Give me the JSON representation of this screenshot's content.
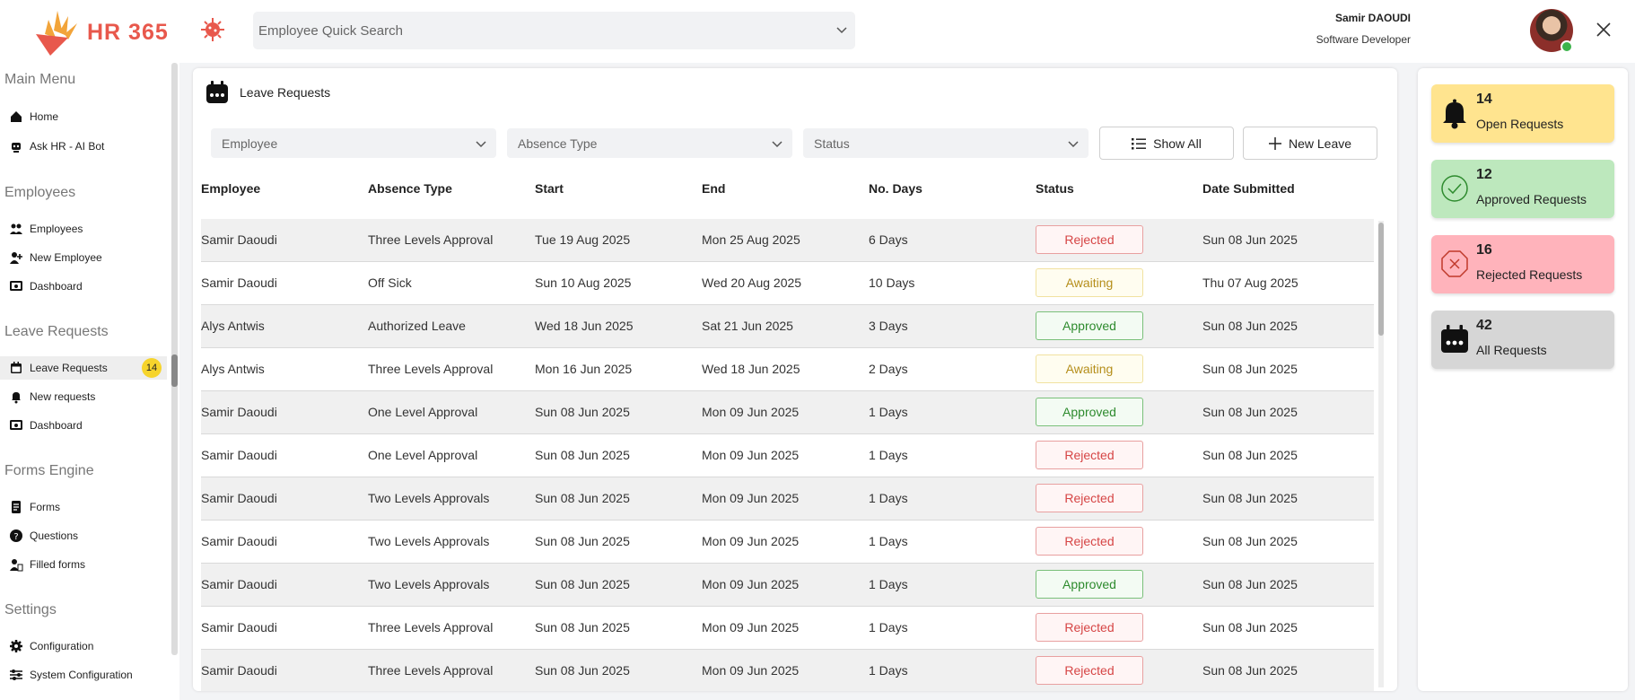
{
  "header": {
    "logo_text": "HR 365",
    "search_placeholder": "Employee Quick Search",
    "user_name": "Samir DAOUDI",
    "user_role": "Software Developer"
  },
  "sidebar": {
    "sections": [
      {
        "title": "Main Menu",
        "items": [
          {
            "label": "Home",
            "icon": "home-icon"
          },
          {
            "label": "Ask HR - AI Bot",
            "icon": "bot-icon"
          }
        ]
      },
      {
        "title": "Employees",
        "items": [
          {
            "label": "Employees",
            "icon": "people-icon"
          },
          {
            "label": "New Employee",
            "icon": "add-person-icon"
          },
          {
            "label": "Dashboard",
            "icon": "dashboard-icon"
          }
        ]
      },
      {
        "title": "Leave Requests",
        "items": [
          {
            "label": "Leave Requests",
            "icon": "calendar-icon",
            "badge": "14",
            "active": true
          },
          {
            "label": "New requests",
            "icon": "bell-icon"
          },
          {
            "label": "Dashboard",
            "icon": "dashboard-icon"
          }
        ]
      },
      {
        "title": "Forms Engine",
        "items": [
          {
            "label": "Forms",
            "icon": "form-icon"
          },
          {
            "label": "Questions",
            "icon": "question-icon"
          },
          {
            "label": "Filled forms",
            "icon": "filled-form-icon"
          }
        ]
      },
      {
        "title": "Settings",
        "items": [
          {
            "label": "Configuration",
            "icon": "gear-icon"
          },
          {
            "label": "System Configuration",
            "icon": "sliders-icon"
          }
        ]
      }
    ]
  },
  "main": {
    "title": "Leave Requests",
    "filters": {
      "employee": "Employee",
      "absence_type": "Absence Type",
      "status": "Status"
    },
    "buttons": {
      "show_all": "Show All",
      "new_leave": "New Leave"
    },
    "columns": [
      "Employee",
      "Absence Type",
      "Start",
      "End",
      "No. Days",
      "Status",
      "Date Submitted"
    ],
    "rows": [
      [
        "Samir Daoudi",
        "Three Levels Approval",
        "Tue 19 Aug 2025",
        "Mon 25 Aug 2025",
        "6 Days",
        "Rejected",
        "Sun 08 Jun 2025"
      ],
      [
        "Samir Daoudi",
        "Off Sick",
        "Sun 10 Aug 2025",
        "Wed 20 Aug 2025",
        "10 Days",
        "Awaiting",
        "Thu 07 Aug 2025"
      ],
      [
        "Alys Antwis",
        "Authorized Leave",
        "Wed 18 Jun 2025",
        "Sat 21 Jun 2025",
        "3 Days",
        "Approved",
        "Sun 08 Jun 2025"
      ],
      [
        "Alys Antwis",
        "Three Levels Approval",
        "Mon 16 Jun 2025",
        "Wed 18 Jun 2025",
        "2 Days",
        "Awaiting",
        "Sun 08 Jun 2025"
      ],
      [
        "Samir Daoudi",
        "One Level Approval",
        "Sun 08 Jun 2025",
        "Mon 09 Jun 2025",
        "1 Days",
        "Approved",
        "Sun 08 Jun 2025"
      ],
      [
        "Samir Daoudi",
        "One Level Approval",
        "Sun 08 Jun 2025",
        "Mon 09 Jun 2025",
        "1 Days",
        "Rejected",
        "Sun 08 Jun 2025"
      ],
      [
        "Samir Daoudi",
        "Two Levels Approvals",
        "Sun 08 Jun 2025",
        "Mon 09 Jun 2025",
        "1 Days",
        "Rejected",
        "Sun 08 Jun 2025"
      ],
      [
        "Samir Daoudi",
        "Two Levels Approvals",
        "Sun 08 Jun 2025",
        "Mon 09 Jun 2025",
        "1 Days",
        "Rejected",
        "Sun 08 Jun 2025"
      ],
      [
        "Samir Daoudi",
        "Two Levels Approvals",
        "Sun 08 Jun 2025",
        "Mon 09 Jun 2025",
        "1 Days",
        "Approved",
        "Sun 08 Jun 2025"
      ],
      [
        "Samir Daoudi",
        "Three Levels Approval",
        "Sun 08 Jun 2025",
        "Mon 09 Jun 2025",
        "1 Days",
        "Rejected",
        "Sun 08 Jun 2025"
      ],
      [
        "Samir Daoudi",
        "Three Levels Approval",
        "Sun 08 Jun 2025",
        "Mon 09 Jun 2025",
        "1 Days",
        "Rejected",
        "Sun 08 Jun 2025"
      ]
    ]
  },
  "stats": {
    "open": {
      "count": "14",
      "label": "Open Requests"
    },
    "approved": {
      "count": "12",
      "label": "Approved Requests"
    },
    "rejected": {
      "count": "16",
      "label": "Rejected Requests"
    },
    "all": {
      "count": "42",
      "label": "All Requests"
    }
  },
  "colors": {
    "brand": "#e8584c",
    "badge": "#f6d42c",
    "open": "#ffe48f",
    "approved": "#bde8bd",
    "rejected": "#ffb3bb",
    "all": "#d6d6d6"
  }
}
